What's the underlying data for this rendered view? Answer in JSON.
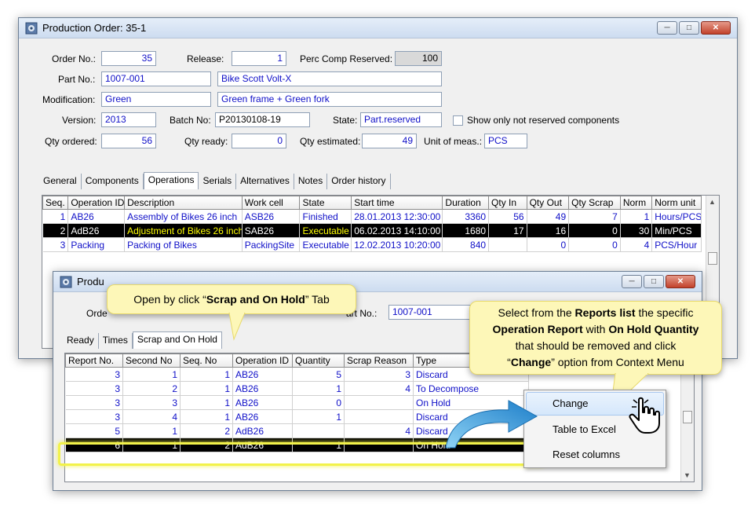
{
  "main_window": {
    "title": "Production Order: 35-1",
    "fields": {
      "order_no_label": "Order No.:",
      "order_no": "35",
      "release_label": "Release:",
      "release": "1",
      "perc_label": "Perc Comp Reserved:",
      "perc": "100",
      "part_no_label": "Part No.:",
      "part_no": "1007-001",
      "part_desc": "Bike Scott Volt-X",
      "modification_label": "Modification:",
      "modification": "Green",
      "modification_desc": "Green frame + Green fork",
      "version_label": "Version:",
      "version": "2013",
      "batch_label": "Batch No:",
      "batch": "P20130108-19",
      "state_label": "State:",
      "state": "Part.reserved",
      "show_label": "Show only not reserved components",
      "qty_ordered_label": "Qty ordered:",
      "qty_ordered": "56",
      "qty_ready_label": "Qty ready:",
      "qty_ready": "0",
      "qty_estimated_label": "Qty estimated:",
      "qty_estimated": "49",
      "uom_label": "Unit of meas.:",
      "uom": "PCS"
    },
    "tabs": [
      "General",
      "Components",
      "Operations",
      "Serials",
      "Alternatives",
      "Notes",
      "Order history"
    ],
    "active_tab": "Operations",
    "grid": {
      "headers": [
        "Seq.",
        "Operation ID",
        "Description",
        "Work cell",
        "State",
        "Start time",
        "Duration",
        "Qty In",
        "Qty Out",
        "Qty Scrap",
        "Norm",
        "Norm unit"
      ],
      "rows": [
        [
          "1",
          "AB26",
          "Assembly of Bikes 26 inch",
          "ASB26",
          "Finished",
          "28.01.2013 12:30:00",
          "3360",
          "56",
          "49",
          "7",
          "1",
          "Hours/PCS"
        ],
        [
          "2",
          "AdB26",
          "Adjustment of Bikes 26 inch",
          "SAB26",
          "Executable",
          "06.02.2013 14:10:00",
          "1680",
          "17",
          "16",
          "0",
          "30",
          "Min/PCS"
        ],
        [
          "3",
          "Packing",
          "Packing of Bikes",
          "PackingSite",
          "Executable",
          "12.02.2013 10:20:00",
          "840",
          "",
          "0",
          "0",
          "4",
          "PCS/Hour"
        ]
      ]
    }
  },
  "sub_window": {
    "title": "Produ",
    "order_label": "Orde",
    "part_label": "art No.:",
    "part_no": "1007-001",
    "tabs": [
      "Ready",
      "Times",
      "Scrap and On Hold"
    ],
    "active_tab": "Scrap and On Hold",
    "grid": {
      "headers": [
        "Report No.",
        "Second No",
        "Seq. No",
        "Operation ID",
        "Quantity",
        "Scrap Reason",
        "Type"
      ],
      "rows": [
        [
          "3",
          "1",
          "1",
          "AB26",
          "5",
          "3",
          "Discard"
        ],
        [
          "3",
          "2",
          "1",
          "AB26",
          "1",
          "4",
          "To Decompose"
        ],
        [
          "3",
          "3",
          "1",
          "AB26",
          "0",
          "",
          "On Hold"
        ],
        [
          "3",
          "4",
          "1",
          "AB26",
          "1",
          "",
          "Discard"
        ],
        [
          "5",
          "1",
          "2",
          "AdB26",
          "",
          "4",
          "Discard"
        ],
        [
          "6",
          "1",
          "2",
          "AdB26",
          "1",
          "",
          "On Hold"
        ]
      ]
    }
  },
  "callouts": {
    "tab_hint": {
      "pre": "Open by click “",
      "bold": "Scrap and On Hold",
      "post": "” Tab"
    },
    "reports_hint": {
      "l1_pre": "Select from the ",
      "l1_bold": "Reports list",
      "l1_post": " the specific",
      "l2_bold1": "Operation Report",
      "l2_mid": " with ",
      "l2_bold2": "On Hold Quantity",
      "l3": "that should be removed and click",
      "l4_pre": "“",
      "l4_bold": "Change",
      "l4_post": "” option from Context Menu"
    }
  },
  "context_menu": {
    "items": [
      "Change",
      "Table to Excel",
      "Reset columns"
    ]
  }
}
